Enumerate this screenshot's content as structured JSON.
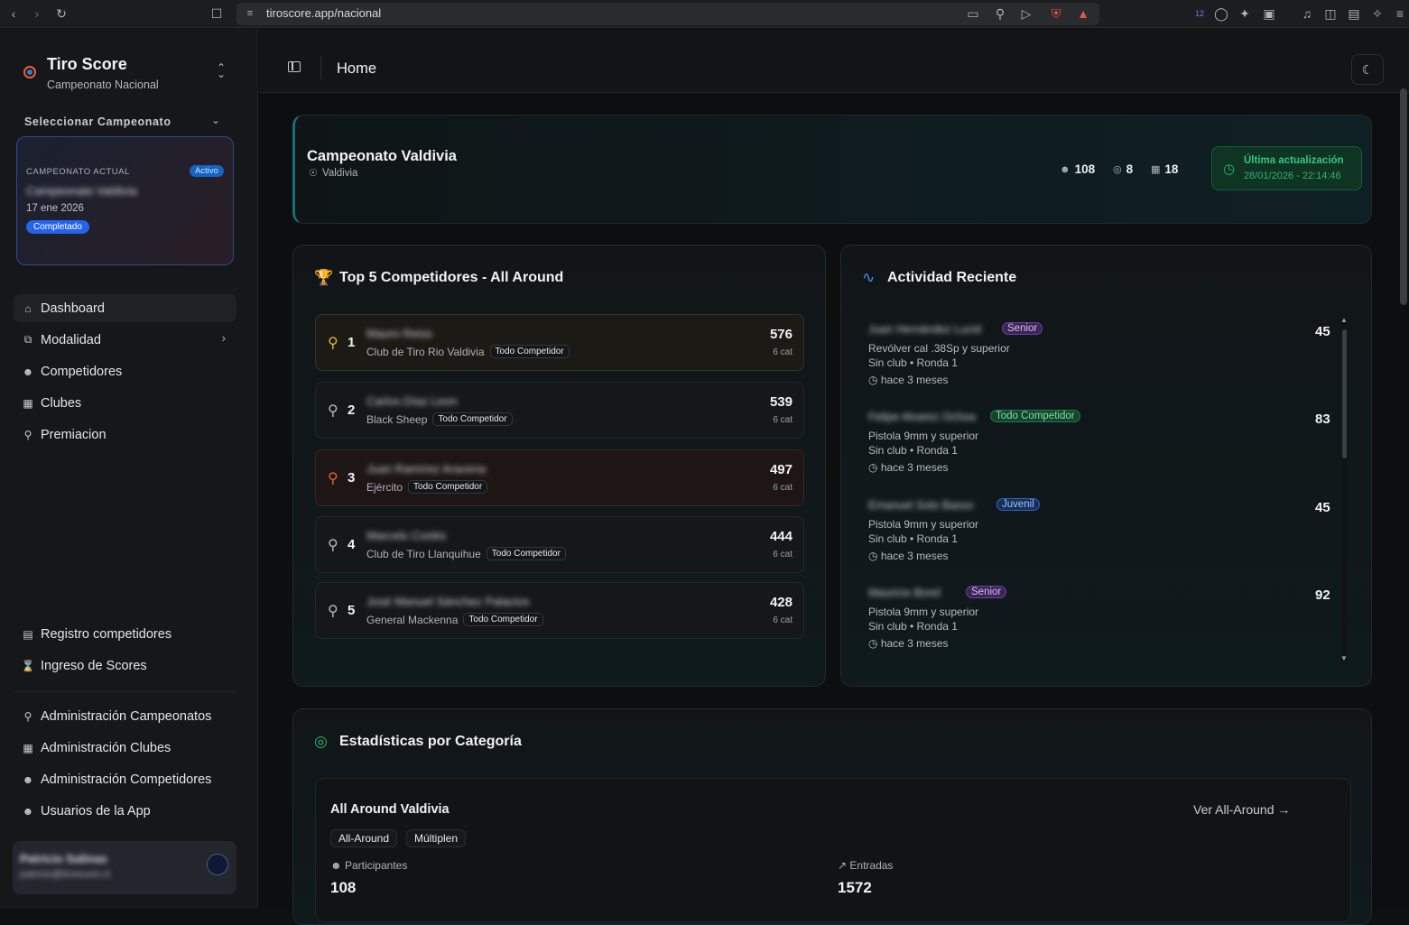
{
  "browser": {
    "url": "tiroscore.app/nacional",
    "ext_badge": "12"
  },
  "sidebar": {
    "brand_title": "Tiro Score",
    "brand_subtitle": "Campeonato Nacional",
    "select_label": "Seleccionar Campeonato",
    "current": {
      "label": "CAMPEONATO ACTUAL",
      "status": "Activo",
      "name": "Campeonato Valdivia",
      "date": "17 ene 2026",
      "state": "Completado"
    },
    "nav": [
      {
        "label": "Dashboard",
        "icon": "home-icon"
      },
      {
        "label": "Modalidad",
        "icon": "layers-icon"
      },
      {
        "label": "Competidores",
        "icon": "users-icon"
      },
      {
        "label": "Clubes",
        "icon": "building-icon"
      },
      {
        "label": "Premiacion",
        "icon": "trophy-icon"
      }
    ],
    "nav2": [
      {
        "label": "Registro competidores",
        "icon": "clipboard-icon"
      },
      {
        "label": "Ingreso de Scores",
        "icon": "hourglass-icon"
      }
    ],
    "admin": [
      {
        "label": "Administración Campeonatos",
        "icon": "trophy-icon"
      },
      {
        "label": "Administración Clubes",
        "icon": "building-icon"
      },
      {
        "label": "Administración Competidores",
        "icon": "users-icon"
      },
      {
        "label": "Usuarios de la App",
        "icon": "users-icon"
      }
    ],
    "user": {
      "name": "Patricio Salinas",
      "email": "patricio@tiroscore.cl"
    }
  },
  "topbar": {
    "title": "Home"
  },
  "hero": {
    "title": "Campeonato Valdivia",
    "location": "Valdivia",
    "participants": "108",
    "modalities": "8",
    "clubs": "18",
    "update_label": "Última actualización",
    "update_time": "28/01/2026 - 22:14:46"
  },
  "top5": {
    "title": "Top 5 Competidores - All Around",
    "rows": [
      {
        "rank": "1",
        "name": "Mauro Reiss",
        "club": "Club de Tiro Rio Valdivia",
        "tag": "Todo Competidor",
        "score": "576",
        "cat": "6 cat"
      },
      {
        "rank": "2",
        "name": "Carlos Díaz Leon",
        "club": "Black Sheep",
        "tag": "Todo Competidor",
        "score": "539",
        "cat": "6 cat"
      },
      {
        "rank": "3",
        "name": "Juan Ramírez Aravena",
        "club": "Ejército",
        "tag": "Todo Competidor",
        "score": "497",
        "cat": "6 cat"
      },
      {
        "rank": "4",
        "name": "Marcelo Cortés",
        "club": "Club de Tiro Llanquihue",
        "tag": "Todo Competidor",
        "score": "444",
        "cat": "6 cat"
      },
      {
        "rank": "5",
        "name": "José Manuel Sánchez Palacios",
        "club": "General Mackenna",
        "tag": "Todo Competidor",
        "score": "428",
        "cat": "6 cat"
      }
    ]
  },
  "activity": {
    "title": "Actividad Reciente",
    "items": [
      {
        "name": "Juan Hernández Lucid",
        "badge": "Senior",
        "badge_kind": "senior",
        "category": "Revólver cal .38Sp y superior",
        "meta": "Sin club • Ronda 1",
        "time": "hace 3 meses",
        "score": "45"
      },
      {
        "name": "Felipe Alvarez Ochoa",
        "badge": "Todo Competidor",
        "badge_kind": "todo",
        "category": "Pistola 9mm y superior",
        "meta": "Sin club • Ronda 1",
        "time": "hace 3 meses",
        "score": "83"
      },
      {
        "name": "Emanuel Soto Basso",
        "badge": "Juvenil",
        "badge_kind": "juvenil",
        "category": "Pistola 9mm y superior",
        "meta": "Sin club • Ronda 1",
        "time": "hace 3 meses",
        "score": "45"
      },
      {
        "name": "Mauricio Borel",
        "badge": "Senior",
        "badge_kind": "senior",
        "category": "Pistola 9mm y superior",
        "meta": "Sin club • Ronda 1",
        "time": "hace 3 meses",
        "score": "92"
      }
    ]
  },
  "stats": {
    "title": "Estadísticas por Categoría",
    "card_title": "All Around Valdivia",
    "link": "Ver All-Around",
    "tags": [
      "All-Around",
      "Múltiplen"
    ],
    "participants_label": "Participantes",
    "participants": "108",
    "entries_label": "Entradas",
    "entries": "1572"
  }
}
